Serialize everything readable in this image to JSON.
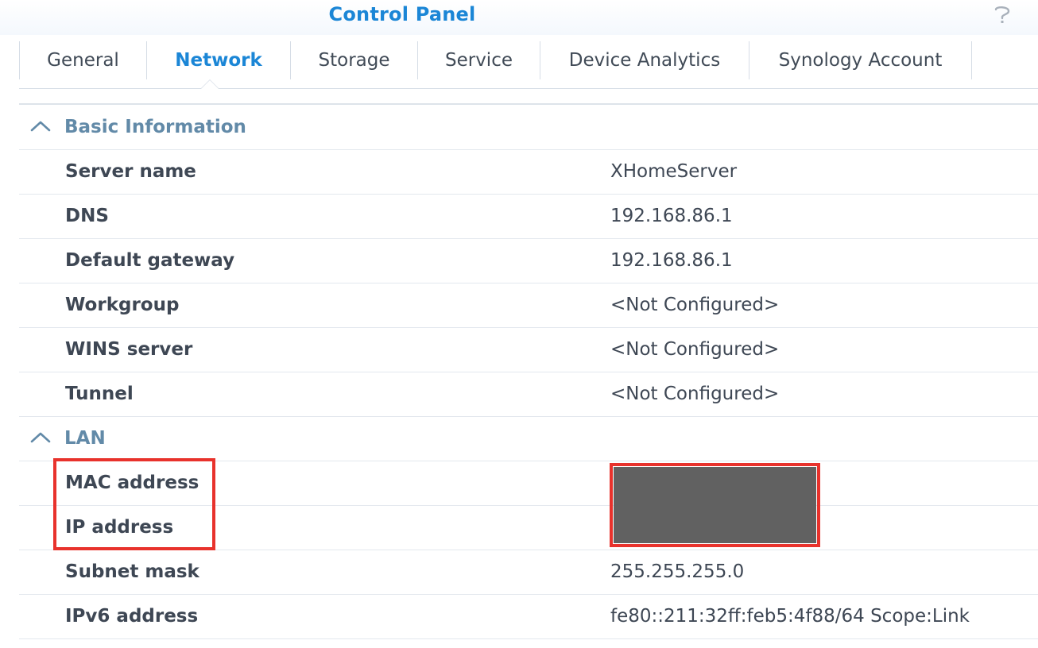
{
  "window": {
    "title": "Control Panel",
    "help_icon": "help-question-icon"
  },
  "tabs": [
    {
      "label": "General",
      "active": false
    },
    {
      "label": "Network",
      "active": true
    },
    {
      "label": "Storage",
      "active": false
    },
    {
      "label": "Service",
      "active": false
    },
    {
      "label": "Device Analytics",
      "active": false
    },
    {
      "label": "Synology Account",
      "active": false
    }
  ],
  "sections": {
    "basic": {
      "title": "Basic Information",
      "icon": "chevron-up-icon",
      "rows": [
        {
          "label": "Server name",
          "value": "XHomeServer"
        },
        {
          "label": "DNS",
          "value": "192.168.86.1"
        },
        {
          "label": "Default gateway",
          "value": "192.168.86.1"
        },
        {
          "label": "Workgroup",
          "value": "<Not Configured>"
        },
        {
          "label": "WINS server",
          "value": "<Not Configured>"
        },
        {
          "label": "Tunnel",
          "value": "<Not Configured>"
        }
      ]
    },
    "lan": {
      "title": "LAN",
      "icon": "chevron-up-icon",
      "rows": [
        {
          "label": "MAC address",
          "value": ""
        },
        {
          "label": "IP address",
          "value": ""
        },
        {
          "label": "Subnet mask",
          "value": "255.255.255.0"
        },
        {
          "label": "IPv6 address",
          "value": "fe80::211:32ff:feb5:4f88/64 Scope:Link"
        }
      ]
    }
  },
  "annotations": {
    "highlight_color": "#e8322c",
    "redaction_color": "#616161"
  },
  "colors": {
    "accent": "#1b86d6",
    "section_header": "#628aa8",
    "text": "#3e4754"
  }
}
